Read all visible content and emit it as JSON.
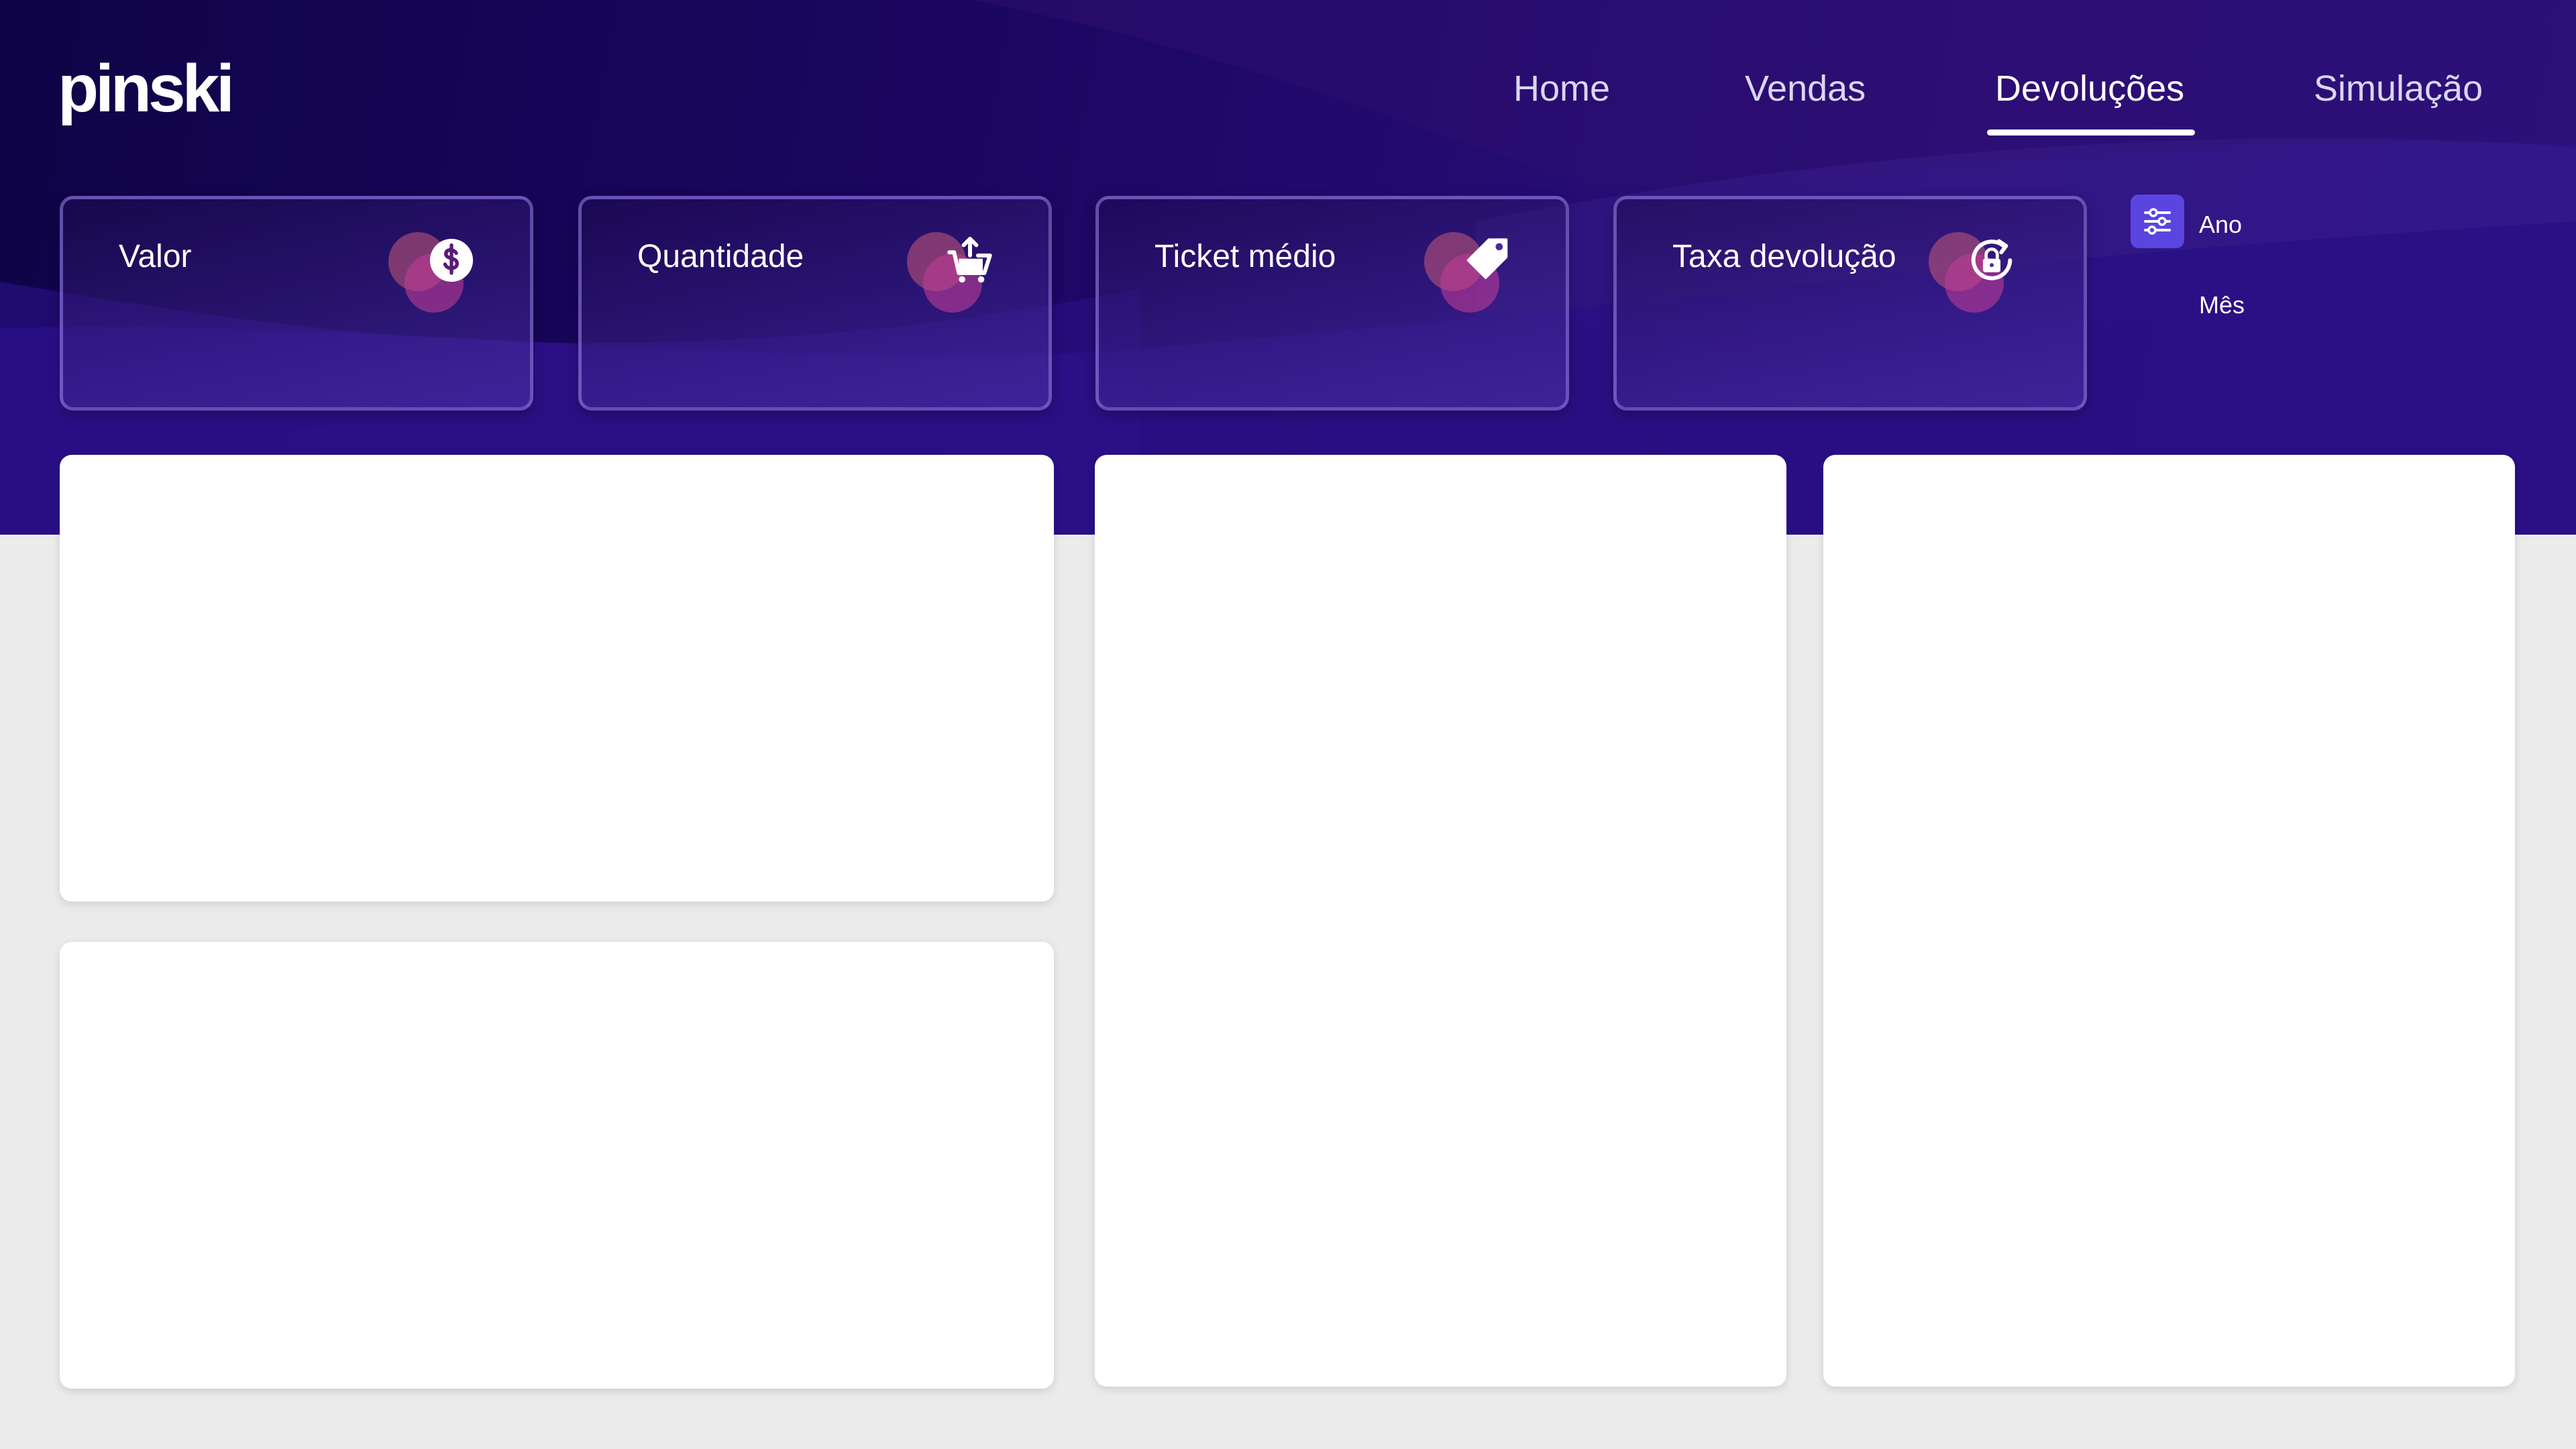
{
  "brand": {
    "logo_text": "pinski"
  },
  "nav": {
    "items": [
      {
        "label": "Home"
      },
      {
        "label": "Vendas"
      },
      {
        "label": "Devoluções",
        "active": true
      },
      {
        "label": "Simulação"
      }
    ]
  },
  "kpis": [
    {
      "title": "Valor",
      "icon": "dollar-circle-icon"
    },
    {
      "title": "Quantidade",
      "icon": "shopping-basket-return-icon"
    },
    {
      "title": "Ticket médio",
      "icon": "price-tag-icon"
    },
    {
      "title": "Taxa devolução",
      "icon": "lock-refresh-icon"
    }
  ],
  "filter": {
    "icon": "sliders-icon",
    "options": [
      "Ano",
      "Mês"
    ]
  },
  "colors": {
    "header_dark": "#0f0447",
    "header_light": "#2d1287",
    "accent": "#5b45e0",
    "page_background": "#ebebeb",
    "panel_background": "#ffffff"
  }
}
